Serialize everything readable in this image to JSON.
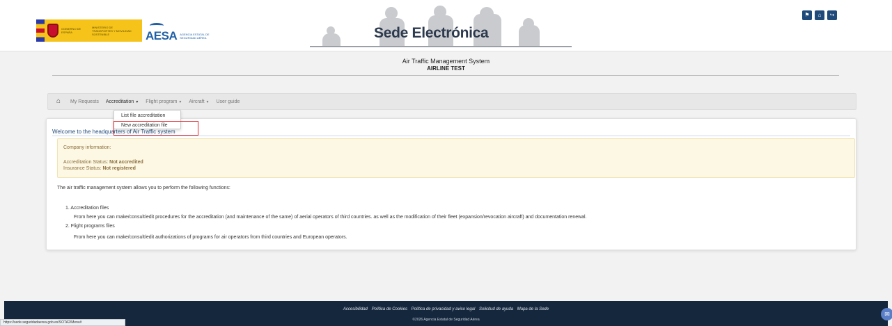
{
  "header": {
    "gov_text": "GOBIERNO DE ESPAÑA",
    "ministry_text": "MINISTERIO DE TRANSPORTES Y MOVILIDAD SOSTENIBLE",
    "aesa_text": "AESA",
    "aesa_sub": "AGENCIA ESTATAL DE SEGURIDAD AÉREA",
    "sede_title": "Sede Electrónica",
    "icons": [
      "flag-icon",
      "home-icon",
      "logout-icon"
    ]
  },
  "page": {
    "title": "Air Traffic Management System",
    "subtitle": "AIRLINE TEST"
  },
  "nav": {
    "items": [
      {
        "label": "My Requests",
        "has_caret": false
      },
      {
        "label": "Accreditation",
        "has_caret": true
      },
      {
        "label": "Flight program",
        "has_caret": true
      },
      {
        "label": "Aircraft",
        "has_caret": true
      },
      {
        "label": "User guide",
        "has_caret": false
      }
    ],
    "dropdown": [
      "List file accreditation",
      "New accreditation file"
    ]
  },
  "main": {
    "welcome": "Welcome to the headquarters of Air Traffic system",
    "company_info_title": "Company information:",
    "accreditation_label": "Accreditation Status:",
    "accreditation_value": "Not accredited",
    "insurance_label": "Insurance Status:",
    "insurance_value": "Not registered",
    "intro": "The air traffic management system allows you to perform the following functions:",
    "functions": [
      {
        "title": "1. Accreditation files",
        "desc": "From here you can make/consult/edit procedures for the accreditation (and maintenance of the same) of aerial operators of third countries. as well as the modification of their fleet (expansion/revocation aircraft) and documentation renewal."
      },
      {
        "title": "2. Flight programs files",
        "desc": "From here you can make/consult/edit authorizations of programs for air operators from third countries and European operators."
      }
    ]
  },
  "footer": {
    "links": [
      "Accesibilidad",
      "Política de Cookies",
      "Política de privacidad y aviso legal",
      "Solicitud de ayuda",
      "Mapa de la Sede"
    ],
    "copyright": "©2026 Agencia Estatal de Seguridad Aérea"
  },
  "status_url": "https://sede.seguridadaerea.gob.es/SOTA2/Menu#"
}
